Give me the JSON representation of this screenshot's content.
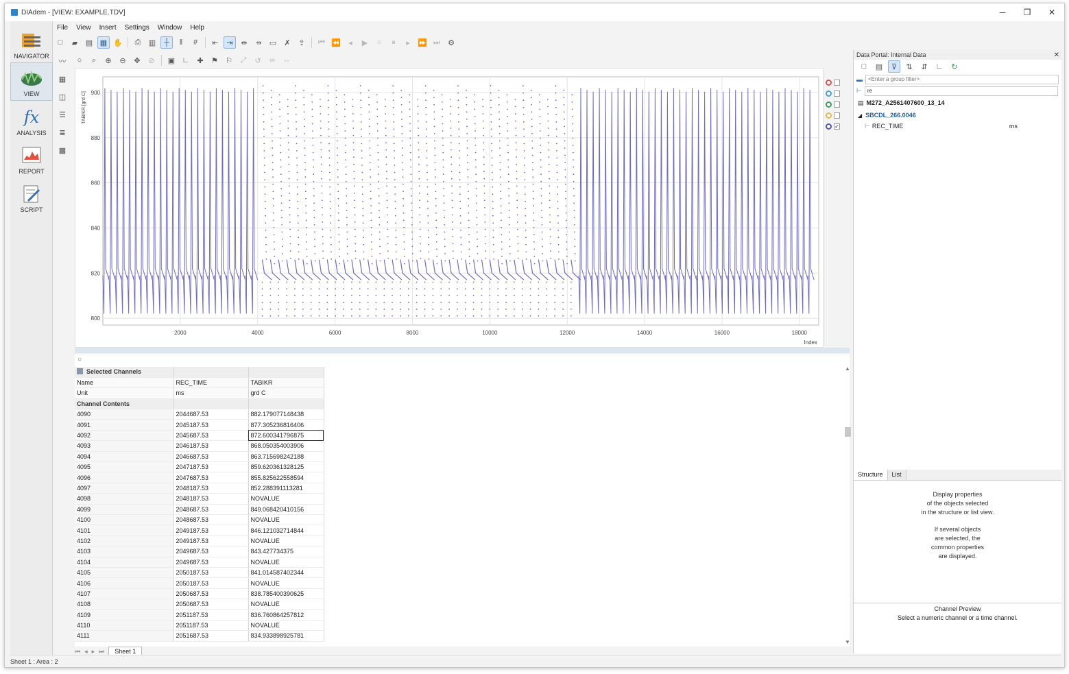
{
  "window": {
    "title": "DIAdem - [VIEW:  EXAMPLE.TDV]",
    "minimize": "─",
    "restore": "❐",
    "close": "✕"
  },
  "panels": [
    {
      "label": "NAVIGATOR",
      "icon": "navigator-icon"
    },
    {
      "label": "VIEW",
      "icon": "view-icon"
    },
    {
      "label": "ANALYSIS",
      "icon": "analysis-icon"
    },
    {
      "label": "REPORT",
      "icon": "report-icon"
    },
    {
      "label": "SCRIPT",
      "icon": "script-icon"
    }
  ],
  "menu": [
    "File",
    "View",
    "Insert",
    "Settings",
    "Window",
    "Help"
  ],
  "chart_data": {
    "type": "line",
    "title": "",
    "xlabel": "Index",
    "ylabel": "TABIKR [grd C]",
    "xlim": [
      0,
      18500
    ],
    "ylim": [
      797,
      907
    ],
    "x_ticks": [
      "2000",
      "4000",
      "6000",
      "8000",
      "10000",
      "12000",
      "14000",
      "16000",
      "18000"
    ],
    "y_ticks": [
      "800",
      "820",
      "840",
      "860",
      "880",
      "900"
    ],
    "series": [
      {
        "color": "#6f6bc2",
        "segments": [
          {
            "from": 0,
            "to": 4100,
            "style": "line",
            "low": 800,
            "high": 902,
            "base": 818
          },
          {
            "from": 4100,
            "to": 12300,
            "style": "dotted",
            "low": 800,
            "high": 903,
            "base": 818
          },
          {
            "from": 12300,
            "to": 18500,
            "style": "line",
            "low": 800,
            "high": 902,
            "base": 818
          }
        ]
      }
    ]
  },
  "legend": [
    {
      "color": "#e05050",
      "checked": false
    },
    {
      "color": "#4aa0d8",
      "checked": false
    },
    {
      "color": "#3aa060",
      "checked": false
    },
    {
      "color": "#e8b84a",
      "checked": false
    },
    {
      "color": "#5a55b0",
      "checked": true
    }
  ],
  "table": {
    "section_title": "Selected Channels",
    "name_label": "Name",
    "unit_label": "Unit",
    "contents_label": "Channel Contents",
    "columns": [
      {
        "name": "REC_TIME",
        "unit": "ms"
      },
      {
        "name": "TABIKR",
        "unit": "grd C"
      }
    ],
    "rows": [
      [
        "4090",
        "2044687.53",
        "882.179077148438"
      ],
      [
        "4091",
        "2045187.53",
        "877.305236816406"
      ],
      [
        "4092",
        "2045687.53",
        "872.600341796875"
      ],
      [
        "4093",
        "2046187.53",
        "868.050354003906"
      ],
      [
        "4094",
        "2046687.53",
        "863.715698242188"
      ],
      [
        "4095",
        "2047187.53",
        "859.620361328125"
      ],
      [
        "4096",
        "2047687.53",
        "855.825622558594"
      ],
      [
        "4097",
        "2048187.53",
        "852.288391113281"
      ],
      [
        "4098",
        "2048187.53",
        "NOVALUE"
      ],
      [
        "4099",
        "2048687.53",
        "849.068420410156"
      ],
      [
        "4100",
        "2048687.53",
        "NOVALUE"
      ],
      [
        "4101",
        "2049187.53",
        "846.121032714844"
      ],
      [
        "4102",
        "2049187.53",
        "NOVALUE"
      ],
      [
        "4103",
        "2049687.53",
        "843.427734375"
      ],
      [
        "4104",
        "2049687.53",
        "NOVALUE"
      ],
      [
        "4105",
        "2050187.53",
        "841.014587402344"
      ],
      [
        "4106",
        "2050187.53",
        "NOVALUE"
      ],
      [
        "4107",
        "2050687.53",
        "838.785400390625"
      ],
      [
        "4108",
        "2050687.53",
        "NOVALUE"
      ],
      [
        "4109",
        "2051187.53",
        "836.760864257812"
      ],
      [
        "4110",
        "2051187.53",
        "NOVALUE"
      ],
      [
        "4111",
        "2051687.53",
        "834.933898925781"
      ]
    ],
    "sheet_tab": "Sheet 1"
  },
  "portal": {
    "title": "Data Portal: Internal Data",
    "close": "✕",
    "group_filter_placeholder": "<Enter a group filter>",
    "channel_filter_value": "re",
    "file_name": "M272_A2561407600_13_14",
    "group_name": "SBCDL_266.0046",
    "channel_name": "REC_TIME",
    "channel_unit": "ms",
    "tab_structure": "Structure",
    "tab_list": "List",
    "props_lines": [
      "Display properties",
      "of the objects selected",
      "in the structure or list view.",
      "",
      "If several objects",
      "are selected, the",
      "common properties",
      "are displayed."
    ],
    "preview_title": "Channel Preview",
    "preview_text": "Select a numeric channel or a time channel."
  },
  "status": {
    "text": "Sheet 1 : Area : 2"
  }
}
